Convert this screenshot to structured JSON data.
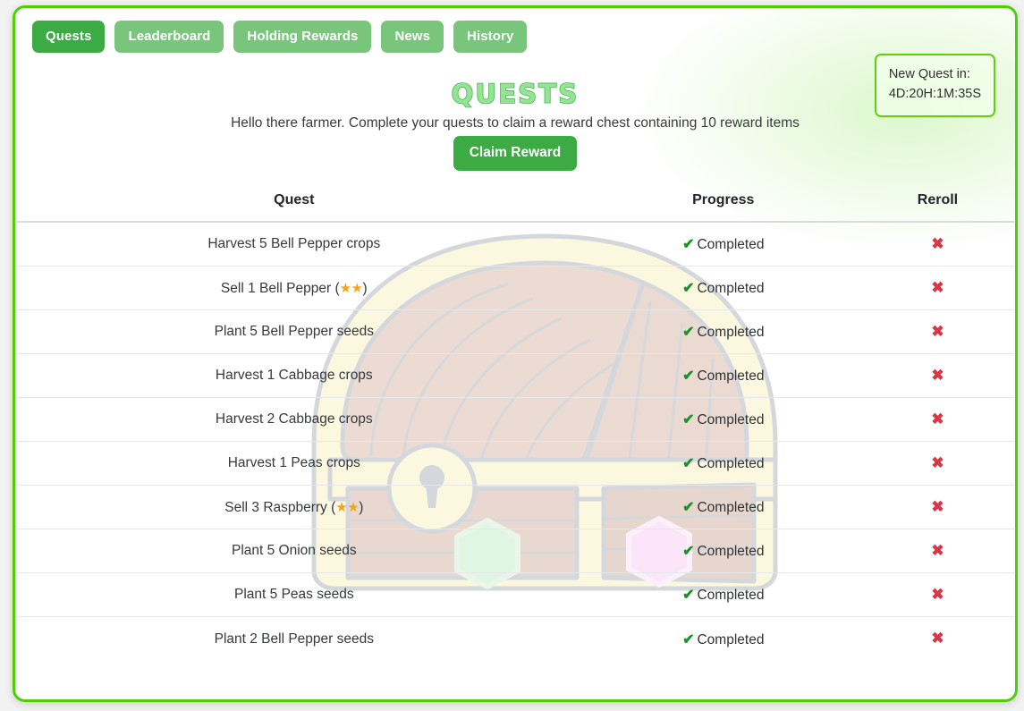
{
  "window": {
    "border_color": "#4ed004",
    "background": "#ffffff"
  },
  "tabs": [
    {
      "label": "Quests",
      "active": true
    },
    {
      "label": "Leaderboard",
      "active": false
    },
    {
      "label": "Holding Rewards",
      "active": false
    },
    {
      "label": "News",
      "active": false
    },
    {
      "label": "History",
      "active": false
    }
  ],
  "timer": {
    "label": "New Quest in:",
    "value": "4D:20H:1M:35S",
    "border_color": "#5fd00a"
  },
  "header": {
    "title": "QUESTS",
    "title_fill": "#93e495",
    "title_stroke": "#49b84c",
    "subtitle": "Hello there farmer. Complete your quests to claim a reward chest containing 10 reward items",
    "claim_label": "Claim Reward",
    "claim_color": "#3cab44"
  },
  "table": {
    "columns": [
      "Quest",
      "Progress",
      "Reroll"
    ],
    "progress_icon": "check-icon",
    "reroll_icon": "x-icon",
    "check_color": "#18922a",
    "x_color": "#dc3545",
    "star_color": "#f6a317",
    "rows": [
      {
        "quest": "Harvest 5 Bell Pepper crops",
        "stars": 0,
        "progress": "Completed",
        "reroll": "✖"
      },
      {
        "quest": "Sell 1 Bell Pepper (",
        "stars": 2,
        "suffix": ")",
        "progress": "Completed",
        "reroll": "✖"
      },
      {
        "quest": "Plant 5 Bell Pepper seeds",
        "stars": 0,
        "progress": "Completed",
        "reroll": "✖"
      },
      {
        "quest": "Harvest 1 Cabbage crops",
        "stars": 0,
        "progress": "Completed",
        "reroll": "✖"
      },
      {
        "quest": "Harvest 2 Cabbage crops",
        "stars": 0,
        "progress": "Completed",
        "reroll": "✖"
      },
      {
        "quest": "Harvest 1 Peas crops",
        "stars": 0,
        "progress": "Completed",
        "reroll": "✖"
      },
      {
        "quest": "Sell 3 Raspberry (",
        "stars": 2,
        "suffix": ")",
        "progress": "Completed",
        "reroll": "✖"
      },
      {
        "quest": "Plant 5 Onion seeds",
        "stars": 0,
        "progress": "Completed",
        "reroll": "✖"
      },
      {
        "quest": "Plant 5 Peas seeds",
        "stars": 0,
        "progress": "Completed",
        "reroll": "✖"
      },
      {
        "quest": "Plant 2 Bell Pepper seeds",
        "stars": 0,
        "progress": "Completed",
        "reroll": "✖"
      }
    ]
  },
  "background_art": {
    "name": "treasure-chest",
    "wood_color": "#c9a38e",
    "trim_color": "#f7edb0",
    "outline_color": "#9aa3ad",
    "gem_left_color": "#a8e8b0",
    "gem_right_color": "#f0b8ea"
  }
}
